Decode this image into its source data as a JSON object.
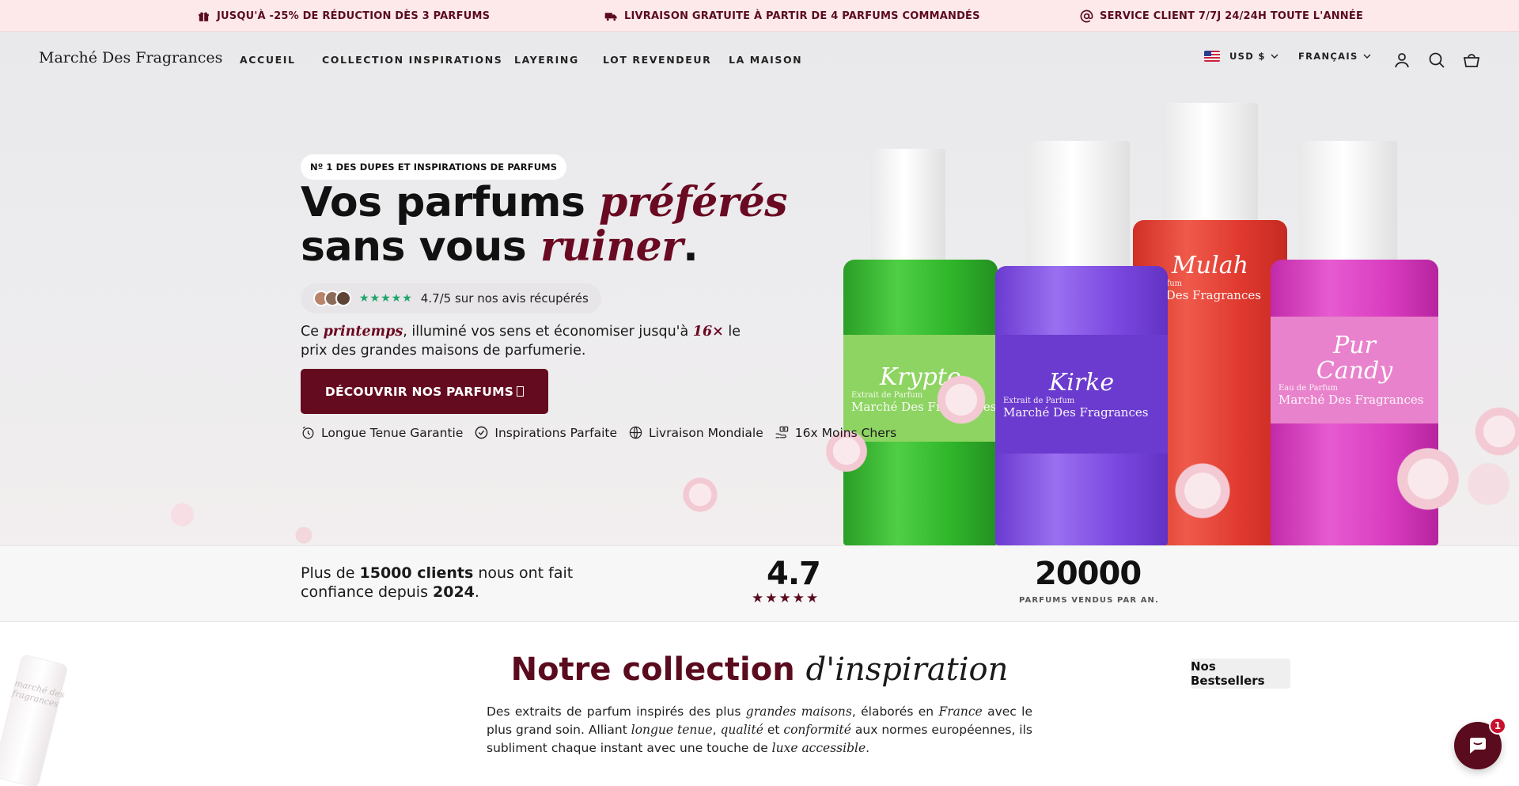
{
  "announcement": {
    "items": [
      {
        "icon": "gift-icon",
        "text": "JUSQU'À -25% DE RÉDUCTION DÈS 3 PARFUMS"
      },
      {
        "icon": "truck-icon",
        "text": "LIVRAISON GRATUITE À PARTIR DE 4 PARFUMS COMMANDÉS"
      },
      {
        "icon": "at-icon",
        "text": "SERVICE CLIENT 7/7J 24/24H TOUTE L'ANNÉE"
      }
    ]
  },
  "header": {
    "logo": "Marché Des Fragrances",
    "nav": [
      "ACCUEIL",
      "COLLECTION INSPIRATIONS",
      "LAYERING",
      "LOT REVENDEUR",
      "LA MAISON"
    ],
    "currency": "USD $",
    "language": "FRANÇAIS",
    "icons": [
      "account-icon",
      "search-icon",
      "cart-icon"
    ]
  },
  "hero": {
    "badge": "Nº 1 DES DUPES ET INSPIRATIONS DE PARFUMS",
    "headline": {
      "part1": "Vos parfums ",
      "accent1": "préférés",
      "part2": " sans vous ",
      "accent2": "ruiner",
      "part3": "."
    },
    "rating": {
      "stars": "★★★★★",
      "text": "4.7/5 sur nos avis récupérés"
    },
    "subtext": {
      "part1": "Ce ",
      "accent1": "printemps",
      "part2": ", illuminé vos sens et économiser jusqu'à ",
      "accent2": "16×",
      "part3": " le prix des grandes maisons de parfumerie."
    },
    "cta": "DÉCOUVRIR NOS PARFUMS ",
    "features": [
      {
        "icon": "clock-icon",
        "text": "Longue Tenue Garantie"
      },
      {
        "icon": "check-circle-icon",
        "text": "Inspirations Parfaite"
      },
      {
        "icon": "globe-icon",
        "text": "Livraison Mondiale"
      },
      {
        "icon": "money-hand-icon",
        "text": "16x Moins Chers"
      }
    ],
    "bottles": [
      {
        "name": "Krypto",
        "small": "Extrait de Parfum",
        "brand": "Marché Des Fragrances",
        "color": "#2fb52a"
      },
      {
        "name": "Kirke",
        "small": "Extrait de Parfum",
        "brand": "Marché Des Fragrances",
        "color": "#7b48e0"
      },
      {
        "name": "Mulah",
        "small": "de Parfum",
        "brand": "ché Des Fragrances",
        "color": "#e0392f"
      },
      {
        "name": "Pur\nCandy",
        "small": "Eau de Parfum",
        "brand": "Marché Des Fragrances",
        "color": "#d93cc0"
      }
    ]
  },
  "stats": {
    "trust": {
      "prefix": "Plus de ",
      "count": "15000 clients",
      "middle": " nous ont fait confiance depuis ",
      "year": "2024",
      "suffix": "."
    },
    "rating_value": "4.7",
    "rating_stars": "★★★★★",
    "sold_value": "20000",
    "sold_caption": "PARFUMS VENDUS PAR AN."
  },
  "collection": {
    "title_plain": "Notre collection ",
    "title_accent": "d'inspiration",
    "bestsellers_button": "Nos Bestsellers",
    "desc": {
      "p1": "Des extraits de parfum inspirés des plus ",
      "e1": "grandes maisons",
      "p2": ", élaborés en ",
      "e2": "France",
      "p3": " avec le plus grand soin. Alliant ",
      "e3": "longue tenue",
      "p4": ", ",
      "e4": "qualité",
      "p5": " et ",
      "e5": "conformité",
      "p6": " aux normes européennes, ils subliment chaque instant avec une touche de ",
      "e6": "luxe accessible",
      "p7": "."
    },
    "side_bottle_text": "marché des fragrances"
  },
  "chat": {
    "badge_count": "1"
  },
  "colors": {
    "brand": "#650b1f",
    "announce_bg": "#fde8ea",
    "rating_green": "#1fa56a"
  }
}
